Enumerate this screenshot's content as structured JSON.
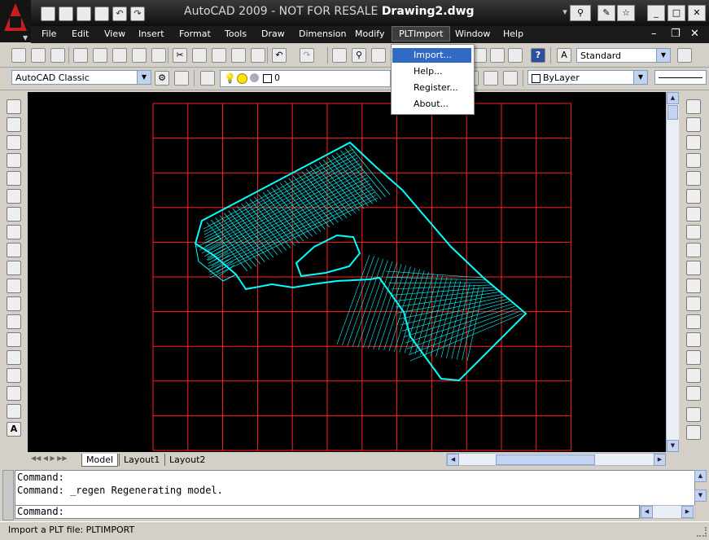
{
  "window": {
    "app_name": "AutoCAD 2009 - NOT FOR RESALE",
    "document_name": "Drawing2.dwg"
  },
  "menubar": {
    "items": [
      "File",
      "Edit",
      "View",
      "Insert",
      "Format",
      "Tools",
      "Draw",
      "Dimension",
      "Modify",
      "PLTImport",
      "Window",
      "Help"
    ],
    "active": "PLTImport"
  },
  "plt_menu": {
    "items": [
      "Import...",
      "Help...",
      "Register...",
      "About..."
    ],
    "selected": "Import..."
  },
  "toolbars": {
    "text_style": "Standard",
    "workspace": "AutoCAD Classic",
    "layer_value": "0",
    "color_value": "ByLayer"
  },
  "layout_tabs": [
    "Model",
    "Layout1",
    "Layout2"
  ],
  "active_tab": "Model",
  "command_history": [
    "Command:",
    "Command:  _regen Regenerating model."
  ],
  "command_prompt": "Command:",
  "status_text": "Import a PLT file: PLTIMPORT",
  "colors": {
    "canvas_bg": "#000000",
    "grid": "#ff2020",
    "wireframe": "#00ffff",
    "menu_highlight": "#316ac5"
  }
}
